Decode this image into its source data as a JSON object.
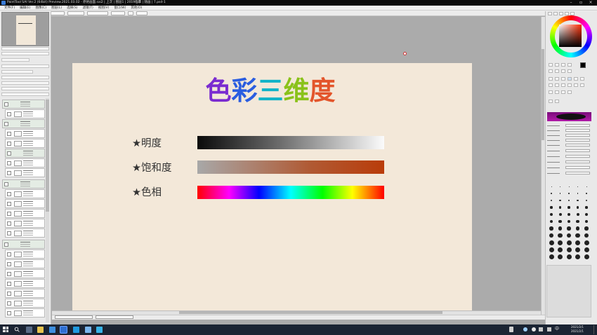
{
  "window": {
    "title": "PaintTool SAI Ver.2 (64bit) Preview.2021.03.02 - 原始画面.sai2 | 上次 | 图层1 | 2019临摹 | 随画 | 7.psd-1"
  },
  "menu": {
    "items": [
      "文件(F)",
      "编辑(E)",
      "图像(C)",
      "图层(L)",
      "选择(S)",
      "滤镜(T)",
      "视图(V)",
      "窗口(W)",
      "其他(O)"
    ]
  },
  "canvas": {
    "title_chars": [
      {
        "char": "色",
        "color": "#7a2bd0"
      },
      {
        "char": "彩",
        "color": "#2a5de0"
      },
      {
        "char": "三",
        "color": "#11b3c8"
      },
      {
        "char": "维",
        "color": "#8ac21a"
      },
      {
        "char": "度",
        "color": "#e3552b"
      }
    ],
    "labels": {
      "brightness": "★明度",
      "saturation": "★饱和度",
      "hue": "★色相"
    }
  },
  "taskbar": {
    "time": "2021/2/1",
    "date": "2021/2/1"
  },
  "colors": {
    "accent": "#3a7bd5",
    "paper": "#f3e8d9",
    "canvas_bg": "#ababab"
  }
}
